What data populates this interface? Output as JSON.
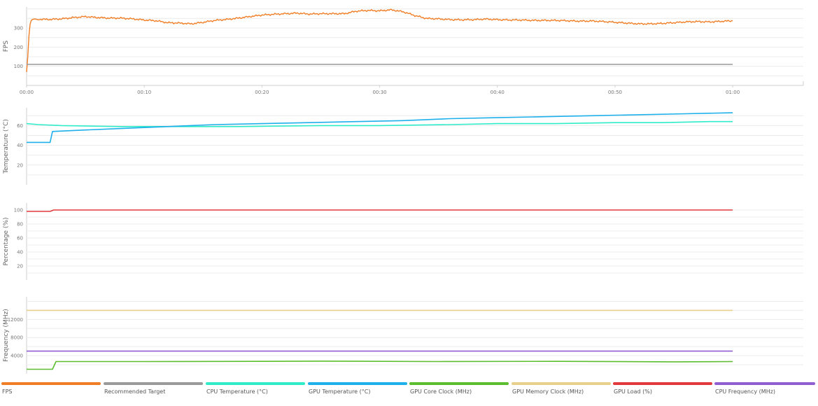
{
  "chart_data": [
    {
      "type": "line",
      "ylabel": "FPS",
      "ylim": [
        0,
        410
      ],
      "yticks": [
        100,
        200,
        300
      ],
      "xlim": [
        0,
        66
      ],
      "xticks": [
        "00:00",
        "00:10",
        "00:20",
        "00:30",
        "00:40",
        "00:50",
        "01:00"
      ],
      "series": [
        {
          "name": "FPS",
          "color": "#f07e26",
          "x": [
            0,
            0.1,
            0.2,
            0.3,
            0.4,
            0.5,
            0.7,
            1,
            2,
            3,
            4,
            5,
            6,
            7,
            8,
            9,
            10,
            11,
            12,
            13,
            14,
            15,
            16,
            17,
            18,
            19,
            20,
            21,
            22,
            23,
            24,
            25,
            26,
            27,
            28,
            29,
            30,
            31,
            32,
            33,
            34,
            35,
            36,
            37,
            38,
            39,
            40,
            41,
            42,
            43,
            44,
            45,
            46,
            47,
            48,
            49,
            50,
            51,
            52,
            53,
            54,
            55,
            56,
            57,
            58,
            59,
            60
          ],
          "y": [
            70,
            150,
            260,
            320,
            340,
            345,
            348,
            346,
            345,
            348,
            355,
            360,
            355,
            352,
            352,
            348,
            342,
            338,
            328,
            326,
            322,
            330,
            340,
            345,
            352,
            360,
            368,
            372,
            375,
            378,
            373,
            375,
            375,
            375,
            388,
            392,
            390,
            395,
            385,
            365,
            350,
            348,
            344,
            343,
            344,
            347,
            344,
            342,
            342,
            340,
            340,
            340,
            338,
            336,
            337,
            334,
            330,
            326,
            322,
            322,
            324,
            328,
            332,
            334,
            332,
            335,
            338
          ]
        },
        {
          "name": "Recommended Target",
          "color": "#999999",
          "x": [
            0,
            60
          ],
          "y": [
            110,
            110
          ]
        }
      ]
    },
    {
      "type": "line",
      "ylabel": "Temperature (°C)",
      "ylim": [
        0,
        78
      ],
      "yticks": [
        20,
        40,
        60
      ],
      "xlim": [
        0,
        66
      ],
      "series": [
        {
          "name": "CPU Temperature (°C)",
          "color": "#30ecc9",
          "x": [
            0,
            1,
            3,
            8,
            12,
            15,
            18,
            25,
            30,
            36,
            40,
            45,
            50,
            54,
            58,
            60
          ],
          "y": [
            62,
            61,
            60,
            59,
            59,
            59,
            59,
            60,
            60,
            61,
            62,
            62,
            63,
            63,
            64,
            64
          ]
        },
        {
          "name": "GPU Temperature (°C)",
          "color": "#1eb0ea",
          "x": [
            0,
            2,
            2.2,
            4,
            8,
            12,
            16,
            20,
            24,
            28,
            32,
            36,
            40,
            44,
            48,
            52,
            56,
            60
          ],
          "y": [
            43,
            43,
            54,
            55,
            57,
            59,
            61,
            62,
            63,
            64,
            65,
            67,
            68,
            69,
            70,
            71,
            72,
            73
          ]
        }
      ]
    },
    {
      "type": "line",
      "ylabel": "Percentage (%)",
      "ylim": [
        0,
        110
      ],
      "yticks": [
        20,
        40,
        60,
        80,
        100
      ],
      "xlim": [
        0,
        66
      ],
      "series": [
        {
          "name": "GPU Load (%)",
          "color": "#e23a3c",
          "x": [
            0,
            2,
            2.3,
            60
          ],
          "y": [
            98,
            98,
            100,
            100
          ]
        }
      ]
    },
    {
      "type": "line",
      "ylabel": "Frequency (MHz)",
      "ylim": [
        0,
        17000
      ],
      "yticks": [
        4000,
        8000,
        12000
      ],
      "xlim": [
        0,
        66
      ],
      "series": [
        {
          "name": "GPU Memory Clock (MHz)",
          "color": "#e8cf8c",
          "x": [
            0,
            60
          ],
          "y": [
            14000,
            14000
          ]
        },
        {
          "name": "CPU Frequency (MHz)",
          "color": "#8f5fd1",
          "x": [
            0,
            60
          ],
          "y": [
            5000,
            5000
          ]
        },
        {
          "name": "GPU Core Clock (MHz)",
          "color": "#5cbd2f",
          "x": [
            0,
            2.2,
            2.5,
            10,
            20,
            25,
            35,
            45,
            55,
            60
          ],
          "y": [
            1000,
            1000,
            2700,
            2700,
            2750,
            2800,
            2700,
            2750,
            2650,
            2700
          ]
        }
      ]
    }
  ],
  "legend": [
    {
      "label": "FPS",
      "color": "#f07e26"
    },
    {
      "label": "Recommended Target",
      "color": "#999999"
    },
    {
      "label": "CPU Temperature (°C)",
      "color": "#30ecc9"
    },
    {
      "label": "GPU Temperature (°C)",
      "color": "#1eb0ea"
    },
    {
      "label": "GPU Core Clock (MHz)",
      "color": "#5cbd2f"
    },
    {
      "label": "GPU Memory Clock (MHz)",
      "color": "#e8cf8c"
    },
    {
      "label": "GPU Load (%)",
      "color": "#e23a3c"
    },
    {
      "label": "CPU Frequency (MHz)",
      "color": "#8f5fd1"
    }
  ]
}
